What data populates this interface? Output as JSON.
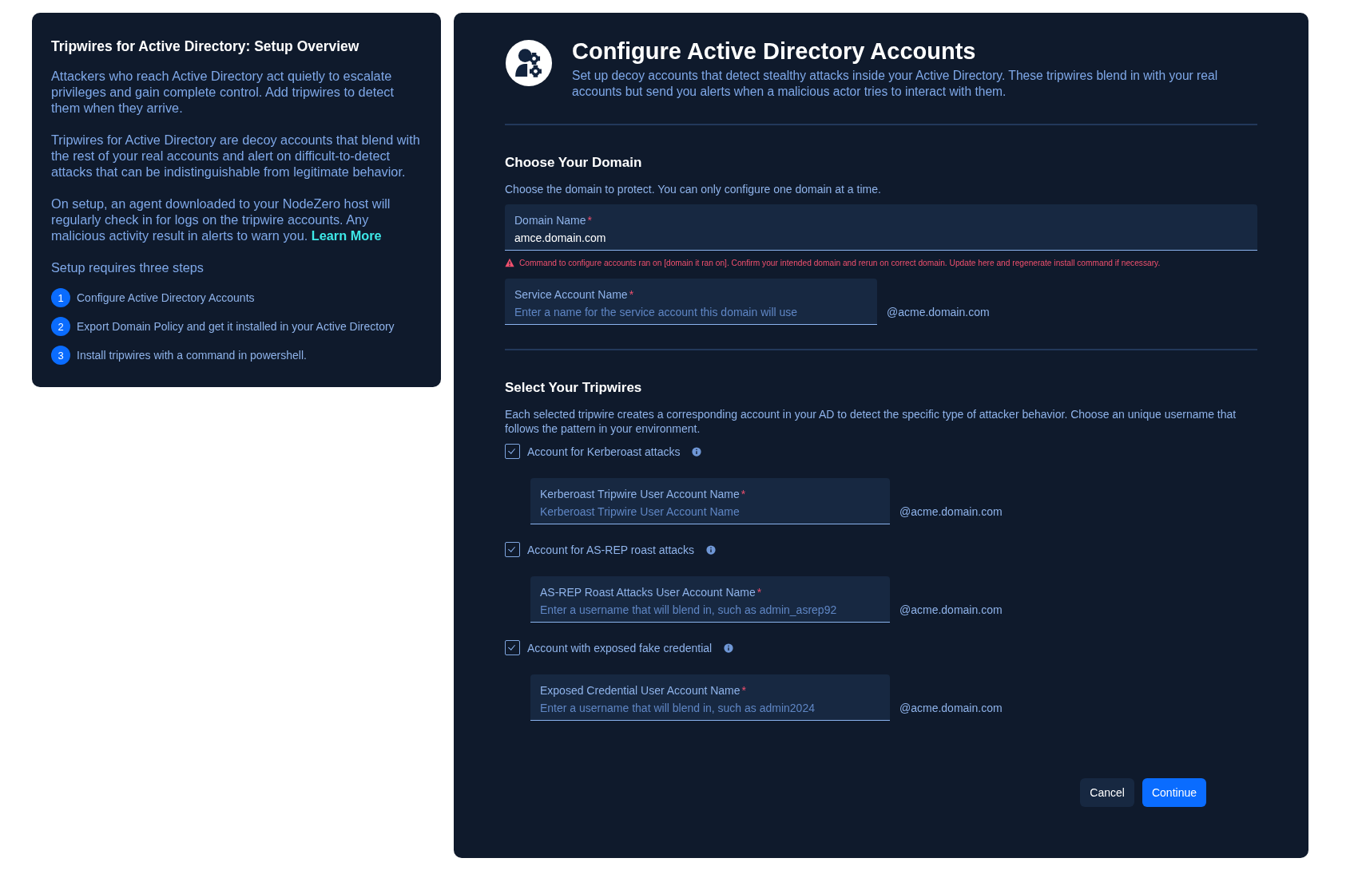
{
  "overview": {
    "title": "Tripwires for Active Directory: Setup Overview",
    "paragraphs": [
      "Attackers who reach Active Directory act quietly to escalate privileges and gain complete control. Add tripwires to detect them when they arrive.",
      "Tripwires for Active Directory are decoy accounts that blend with the rest of your real accounts and alert on difficult-to-detect attacks that can be indistinguishable from legitimate behavior.",
      "On setup, an agent downloaded to your NodeZero host will regularly check in for logs on the tripwire accounts. Any malicious activity result in alerts to warn you."
    ],
    "link": "Learn More",
    "steps_intro": "Setup requires three steps",
    "steps": [
      {
        "number": "1",
        "label": "Configure Active Directory Accounts"
      },
      {
        "number": "2",
        "label": "Export Domain Policy and get it installed in your Active Directory"
      },
      {
        "number": "3",
        "label": "Install tripwires with a command in powershell."
      }
    ]
  },
  "header": {
    "title": "Configure Active Directory Accounts",
    "description": "Set up decoy accounts that detect stealthy attacks inside your Active Directory. These tripwires blend in with your real accounts but send you alerts when a malicious actor tries to interact with them."
  },
  "domain_section": {
    "title": "Choose Your Domain",
    "description": "Choose the domain to protect. You can only configure one domain at a time.",
    "domain_field": {
      "label": "Domain Name",
      "required_mark": "*",
      "value": "amce.domain.com"
    },
    "error": "Command to configure accounts ran on [domain it ran on]. Confirm your intended domain and rerun on correct domain. Update here and regenerate install command if necessary.",
    "service_field": {
      "label": "Service Account Name",
      "required_mark": "*",
      "placeholder": "Enter a name for the service account this domain will use",
      "suffix": "@acme.domain.com"
    }
  },
  "tripwires_section": {
    "title": "Select Your Tripwires",
    "description": "Each selected tripwire creates a corresponding account in your AD to detect the specific type of attacker behavior. Choose an unique username that follows the pattern in your environment.",
    "tripwires": [
      {
        "label": "Account for Kerberoast attacks",
        "checked": true,
        "field": {
          "label": "Kerberoast Tripwire User Account Name",
          "required_mark": "*",
          "placeholder": "Kerberoast Tripwire User Account Name"
        },
        "suffix": "@acme.domain.com"
      },
      {
        "label": "Account for AS-REP roast attacks",
        "checked": true,
        "field": {
          "label": "AS-REP Roast Attacks User Account Name",
          "required_mark": "*",
          "placeholder": "Enter a username that will blend in, such as admin_asrep92"
        },
        "suffix": "@acme.domain.com"
      },
      {
        "label": "Account with exposed fake credential",
        "checked": true,
        "field": {
          "label": "Exposed Credential User Account Name",
          "required_mark": "*",
          "placeholder": "Enter a username that will blend in, such as admin2024"
        },
        "suffix": "@acme.domain.com"
      }
    ]
  },
  "buttons": [
    {
      "label": "Cancel",
      "kind": "secondary"
    },
    {
      "label": "Continue",
      "kind": "primary"
    }
  ]
}
